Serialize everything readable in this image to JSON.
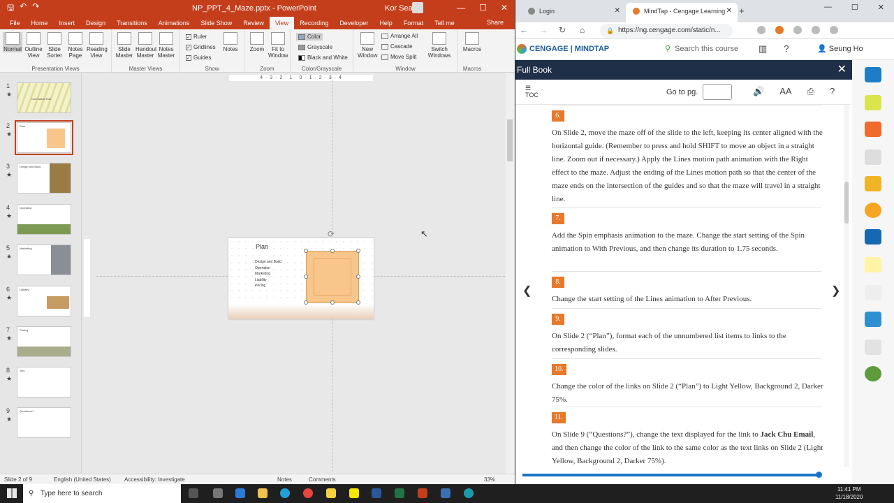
{
  "ppt": {
    "title": {
      "document": "NP_PPT_4_Maze.pptx - PowerPoint",
      "user": "Kor Sean",
      "minimize": "—",
      "maximize": "☐",
      "close": "✕"
    },
    "quick_access": {
      "save": "🖫",
      "undo": "↶",
      "redo": "↷"
    },
    "tabs": [
      "File",
      "Home",
      "Insert",
      "Design",
      "Transitions",
      "Animations",
      "Slide Show",
      "Review",
      "View",
      "Recording",
      "Developer",
      "Help",
      "Format",
      "Tell me"
    ],
    "active_tab": "View",
    "share_label": "Share",
    "ribbon": {
      "presentation_views": {
        "label": "Presentation Views",
        "buttons": [
          "Normal",
          "Outline View",
          "Slide Sorter",
          "Notes Page",
          "Reading View"
        ]
      },
      "master_views": {
        "label": "Master Views",
        "buttons": [
          "Slide Master",
          "Handout Master",
          "Notes Master"
        ]
      },
      "show": {
        "label": "Show",
        "checks": [
          "Ruler",
          "Gridlines",
          "Guides"
        ],
        "notes": "Notes"
      },
      "zoom": {
        "label": "Zoom",
        "buttons": [
          "Zoom",
          "Fit to Window"
        ]
      },
      "color": {
        "label": "Color/Grayscale",
        "options": [
          "Color",
          "Grayscale",
          "Black and White"
        ]
      },
      "window": {
        "label": "Window",
        "new_window": "New Window",
        "options": [
          "Arrange All",
          "Cascade",
          "Move Split"
        ],
        "switch": "Switch Windows"
      },
      "macros": {
        "label": "Macros",
        "button": "Macros"
      }
    },
    "thumbnails": [
      {
        "num": "1",
        "title": "Corn Maze Tour"
      },
      {
        "num": "2",
        "title": "Plan"
      },
      {
        "num": "3",
        "title": "Design and Build"
      },
      {
        "num": "4",
        "title": "Operation"
      },
      {
        "num": "5",
        "title": "Marketing"
      },
      {
        "num": "6",
        "title": "Liability"
      },
      {
        "num": "7",
        "title": "Pricing"
      },
      {
        "num": "8",
        "title": "Tips"
      },
      {
        "num": "9",
        "title": "Questions?"
      }
    ],
    "active_slide": 2,
    "slide": {
      "title": "Plan",
      "items": [
        "Design and Build",
        "Operation",
        "Marketing",
        "Liability",
        "Pricing"
      ]
    },
    "ruler_text": "4 · 3 · 2 · 1 · 0 · 1 · 2 · 3 · 4",
    "status": {
      "slide": "Slide 2 of 9",
      "language": "English (United States)",
      "accessibility": "Accessibility: Investigate",
      "notes": "Notes",
      "comments": "Comments",
      "zoom": "33%"
    }
  },
  "browser": {
    "tabs": [
      {
        "label": "Login",
        "active": false,
        "color": "#888888"
      },
      {
        "label": "MindTap - Cengage Learning",
        "active": true,
        "color": "#e8782a"
      }
    ],
    "url": "https://ng.cengage.com/static/n...",
    "window": {
      "minimize": "—",
      "maximize": "☐",
      "close": "✕"
    },
    "new_tab": "+"
  },
  "mindtap": {
    "logo": "CENGAGE | MINDTAP",
    "search_placeholder": "Search this course",
    "user": "Seung Ho",
    "panel_title": "Full Book",
    "toc_label": "TOC",
    "goto_label": "Go to pg.",
    "font_label": "AA",
    "steps": [
      {
        "num": "6.",
        "text": "On Slide 2, move the maze off of the slide to the left, keeping its center aligned with the horizontal guide. (Remember to press and hold SHIFT to move an object in a straight line. Zoom out if necessary.) Apply the Lines motion path animation with the Right effect to the maze. Adjust the ending of the Lines motion path so that the center of the maze ends on the intersection of the guides and so that the maze will travel in a straight line."
      },
      {
        "num": "7.",
        "text": "Add the Spin emphasis animation to the maze. Change the start setting of the Spin animation to With Previous, and then change its duration to 1.75 seconds."
      },
      {
        "num": "8.",
        "text": "Change the start setting of the Lines animation to After Previous."
      },
      {
        "num": "9.",
        "text": "On Slide 2 (“Plan”), format each of the unnumbered list items to links to the corresponding slides."
      },
      {
        "num": "10.",
        "text": "Change the color of the links on Slide 2 (“Plan”) to Light Yellow, Background 2, Darker 75%."
      },
      {
        "num": "11.",
        "text_before": "On Slide 9 (“Questions?”), change the text displayed for the link to ",
        "text_bold": "Jack Chu Email",
        "text_after": ", and then change the color of the link to the same color as the text links on Slide 2 (Light Yellow, Background 2, Darker 75%)."
      }
    ],
    "reading_progress": 0.99,
    "accent": "#e8782a"
  },
  "taskbar": {
    "search_placeholder": "Type here to search",
    "time": "11:41 PM",
    "date": "11/18/2020"
  }
}
